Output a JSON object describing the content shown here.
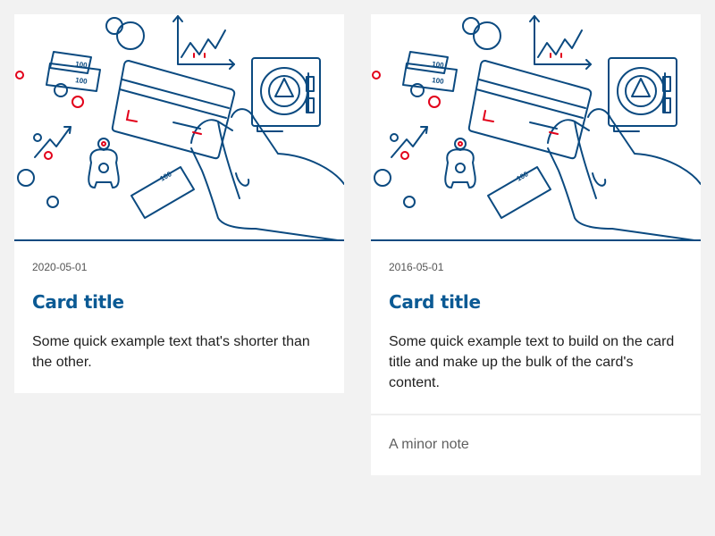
{
  "colors": {
    "page_background": "#f2f2f2",
    "card_background": "#ffffff",
    "title": "#0b5a94",
    "illustration_line": "#0b4a80",
    "illustration_accent": "#e2001a"
  },
  "cards": [
    {
      "illustration": "payment-card-illustration",
      "date": "2020-05-01",
      "title": "Card title",
      "text": "Some quick example text that's shorter than the other."
    },
    {
      "illustration": "payment-card-illustration",
      "date": "2016-05-01",
      "title": "Card title",
      "text": "Some quick example text to build on the card title and make up the bulk of the card's content.",
      "footer": "A minor note"
    }
  ]
}
